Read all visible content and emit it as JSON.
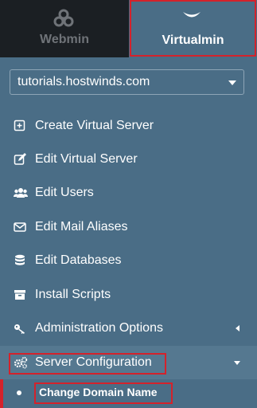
{
  "tabs": {
    "webmin": {
      "label": "Webmin",
      "icon": "webmin-logo-icon"
    },
    "virtualmin": {
      "label": "Virtualmin",
      "icon": "virtualmin-chevron-icon"
    }
  },
  "domain_select": {
    "value": "tutorials.hostwinds.com"
  },
  "menu": {
    "items": [
      {
        "label": "Create Virtual Server",
        "icon": "plus-square-icon"
      },
      {
        "label": "Edit Virtual Server",
        "icon": "edit-icon"
      },
      {
        "label": "Edit Users",
        "icon": "users-icon"
      },
      {
        "label": "Edit Mail Aliases",
        "icon": "envelope-icon"
      },
      {
        "label": "Edit Databases",
        "icon": "database-icon"
      },
      {
        "label": "Install Scripts",
        "icon": "archive-icon"
      },
      {
        "label": "Administration Options",
        "icon": "key-icon"
      },
      {
        "label": "Server Configuration",
        "icon": "cogs-icon"
      }
    ],
    "sub_item": {
      "label": "Change Domain Name"
    }
  },
  "colors": {
    "sidebar_bg": "#4a6d86",
    "dark_tab_bg": "#1b1f23",
    "highlight_red": "#d4222b",
    "active_bg": "#557890"
  }
}
